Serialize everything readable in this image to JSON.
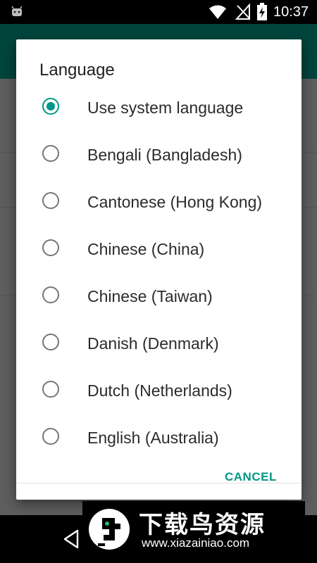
{
  "status_bar": {
    "time": "10:37",
    "icons": [
      "android-icon",
      "wifi-icon",
      "no-signal-icon",
      "battery-charging-icon"
    ]
  },
  "dialog": {
    "title": "Language",
    "options": [
      {
        "label": "Use system language",
        "selected": true
      },
      {
        "label": "Bengali (Bangladesh)",
        "selected": false
      },
      {
        "label": "Cantonese (Hong Kong)",
        "selected": false
      },
      {
        "label": "Chinese (China)",
        "selected": false
      },
      {
        "label": "Chinese (Taiwan)",
        "selected": false
      },
      {
        "label": "Danish (Denmark)",
        "selected": false
      },
      {
        "label": "Dutch (Netherlands)",
        "selected": false
      },
      {
        "label": "English (Australia)",
        "selected": false
      }
    ],
    "cancel_label": "CANCEL"
  },
  "watermark": {
    "title": "下载鸟资源",
    "url": "www.xiazainiao.com"
  },
  "colors": {
    "accent": "#009688",
    "app_bar": "#00453c",
    "scrim_background": "#5e5e5e"
  },
  "navigation": {
    "icons": [
      "back-icon"
    ]
  }
}
